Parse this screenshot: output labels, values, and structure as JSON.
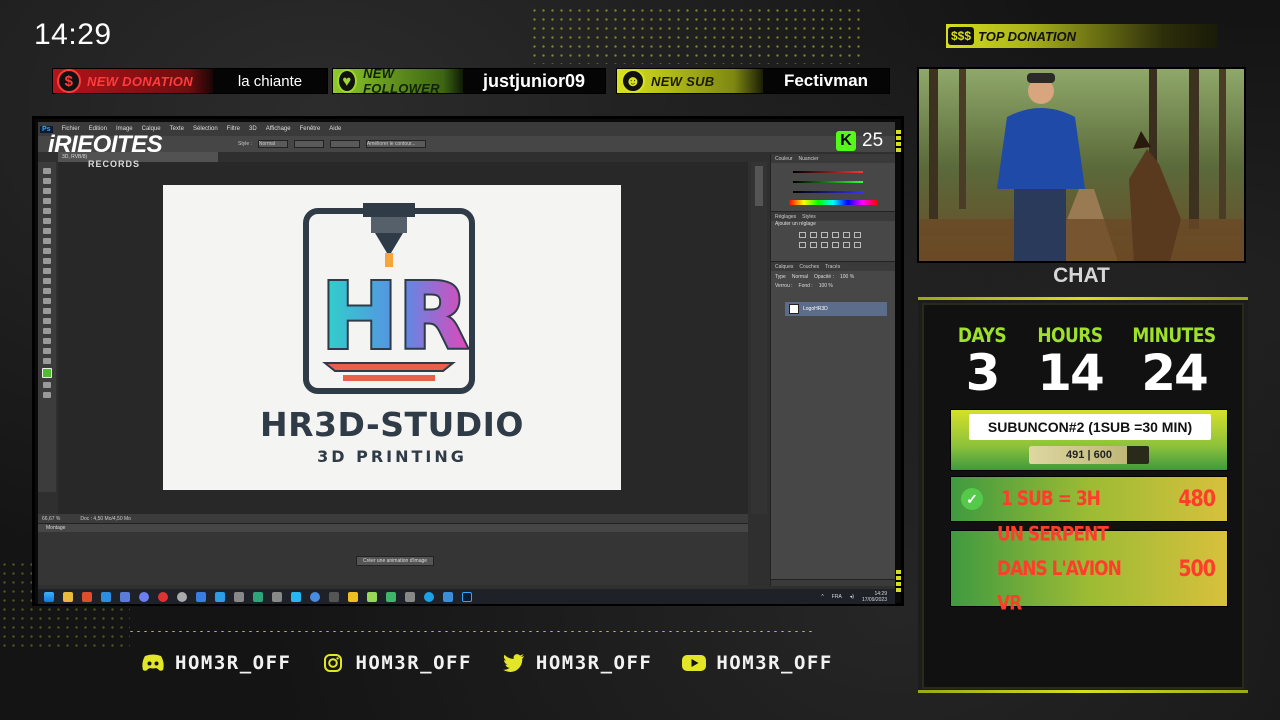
{
  "clock": "14:29",
  "alerts": {
    "donation": {
      "label": "NEW DONATION",
      "value": "la chiante"
    },
    "follower": {
      "label": "NEW FOLLOWER",
      "value": "justjunior09"
    },
    "sub": {
      "label": "NEW SUB",
      "value": "Fectivman"
    }
  },
  "top_donation": {
    "icon_text": "$$$",
    "label": "TOP DONATION"
  },
  "watermark": {
    "line1": "iRIEOITES",
    "line2": "RECORDS"
  },
  "kick": {
    "icon_letter": "K",
    "count": "25"
  },
  "photoshop": {
    "app_badge": "Ps",
    "menu": [
      "Fichier",
      "Edition",
      "Image",
      "Calque",
      "Texte",
      "Sélection",
      "Filtre",
      "3D",
      "Affichage",
      "Fenêtre",
      "Aide"
    ],
    "options": {
      "style_label": "Style :",
      "style_value": "Normal",
      "refine_label": "Améliorer le contour..."
    },
    "doc_tab": "3D, RVB/8)",
    "status": {
      "zoom": "66,67 %",
      "doc": "Doc : 4,50 Mo/4,50 Mo"
    },
    "timeline": {
      "tab": "Montage",
      "button": "Créer une animation d'image"
    },
    "panels": {
      "color_tabs": [
        "Couleur",
        "Nuancier"
      ],
      "color_values": [
        "24",
        "109",
        "172"
      ],
      "adjust_tabs": [
        "Réglages",
        "Styles"
      ],
      "adjust_title": "Ajouter un réglage",
      "layers_tabs": [
        "Calques",
        "Couches",
        "Tracés"
      ],
      "layers_kind": "Type",
      "blend_mode": "Normal",
      "opacity_label": "Opacité :",
      "opacity_value": "100 %",
      "lock_label": "Verrou :",
      "fill_label": "Fond :",
      "fill_value": "100 %",
      "layer_name": "LogoHR3D"
    }
  },
  "document": {
    "brand": "HR3D-STUDIO",
    "tagline": "3D PRINTING",
    "logo_letters": "HR"
  },
  "taskbar": {
    "tray_lang": "FRA",
    "time": "14:29",
    "date": "17/09/2023"
  },
  "webcam_label": "CHAT",
  "timer": {
    "days_label": "DAYS",
    "days": "3",
    "hours_label": "HOURS",
    "hours": "14",
    "minutes_label": "MINUTES",
    "minutes": "24"
  },
  "subathon": {
    "title": "SUBUNCON#2 (1SUB =30 MIN)",
    "progress_text": "491 | 600",
    "current": 491,
    "goal": 600
  },
  "goals": [
    {
      "text": "1 SUB = 3H",
      "value": "480",
      "done": true
    },
    {
      "text": "UN SERPENT DANS L'AVION VR",
      "value": "500",
      "done": false
    }
  ],
  "socials": [
    {
      "icon": "discord-icon",
      "handle": "HOM3R_OFF"
    },
    {
      "icon": "instagram-icon",
      "handle": "HOM3R_OFF"
    },
    {
      "icon": "twitter-icon",
      "handle": "HOM3R_OFF"
    },
    {
      "icon": "youtube-icon",
      "handle": "HOM3R_OFF"
    }
  ],
  "colors": {
    "accent_yellow": "#d7de1f",
    "accent_green": "#9fe12a",
    "alert_red": "#ff3d2a"
  }
}
